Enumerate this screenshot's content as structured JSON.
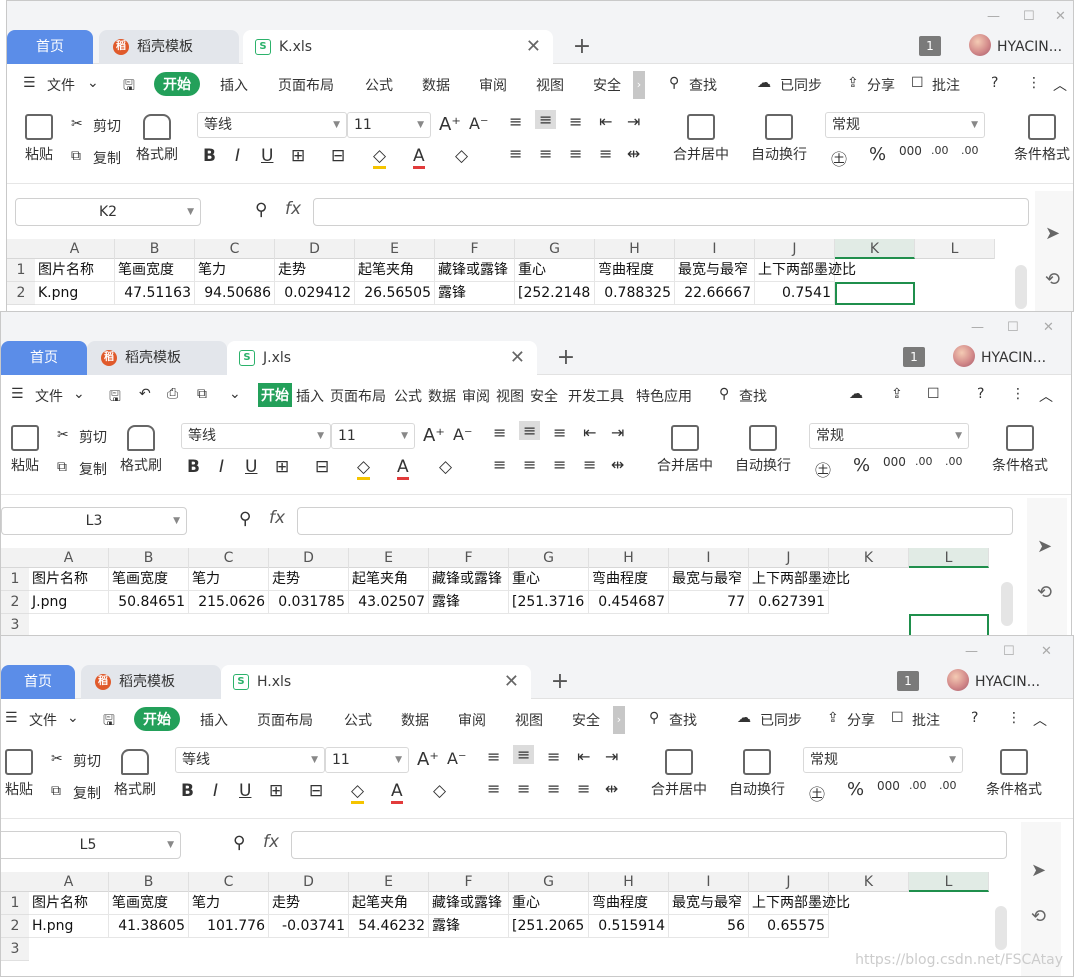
{
  "common": {
    "tab_home": "首页",
    "tab_templates": "稻壳模板",
    "user_name": "HYACIN...",
    "badge": "1",
    "new_tab": "+",
    "menu_file": "文件",
    "menu_start": "开始",
    "menu_insert": "插入",
    "menu_layout": "页面布局",
    "menu_formula": "公式",
    "menu_data": "数据",
    "menu_review": "审阅",
    "menu_view": "视图",
    "menu_security": "安全",
    "menu_devtools": "开发工具",
    "menu_special": "特色应用",
    "menu_search": "查找",
    "menu_sync": "已同步",
    "menu_share": "分享",
    "menu_comment": "批注",
    "paste": "粘贴",
    "cut": "剪切",
    "copy": "复制",
    "format_painter": "格式刷",
    "font_name": "等线",
    "font_size": "11",
    "merge_center": "合并居中",
    "wrap_text": "自动换行",
    "number_format": "常规",
    "conditional_format": "条件格式",
    "fx": "fx"
  },
  "columns": [
    "A",
    "B",
    "C",
    "D",
    "E",
    "F",
    "G",
    "H",
    "I",
    "J",
    "K",
    "L"
  ],
  "headers": [
    "图片名称",
    "笔画宽度",
    "笔力",
    "走势",
    "起笔夹角",
    "藏锋或露锋",
    "重心",
    "弯曲程度",
    "最宽与最窄",
    "上下两部墨迹比"
  ],
  "windows": [
    {
      "filename": "K.xls",
      "namebox": "K2",
      "row2": [
        "K.png",
        "47.51163",
        "94.50686",
        "0.029412",
        "26.56505",
        "露锋",
        "[252.2148",
        "0.788325",
        "22.66667",
        "0.7541"
      ]
    },
    {
      "filename": "J.xls",
      "namebox": "L3",
      "row2": [
        "J.png",
        "50.84651",
        "215.0626",
        "0.031785",
        "43.02507",
        "露锋",
        "[251.3716",
        "0.454687",
        "77",
        "0.627391"
      ]
    },
    {
      "filename": "H.xls",
      "namebox": "L5",
      "row2": [
        "H.png",
        "41.38605",
        "101.776",
        "-0.03741",
        "54.46232",
        "露锋",
        "[251.2065",
        "0.515914",
        "56",
        "0.65575"
      ]
    }
  ],
  "row_numbers": [
    "1",
    "2",
    "3"
  ],
  "watermark": "https://blog.csdn.net/FSCAtay"
}
